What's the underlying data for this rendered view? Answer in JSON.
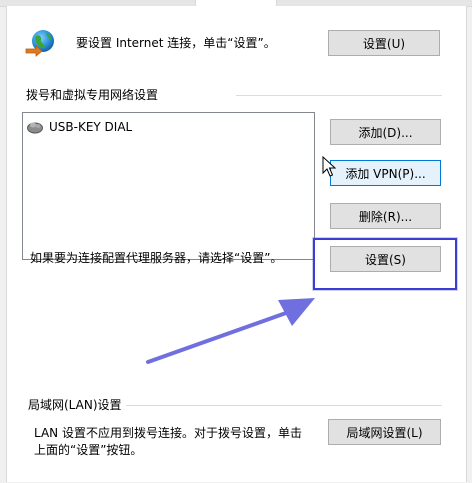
{
  "internet_setup": {
    "text": "要设置 Internet 连接，单击“设置”。",
    "button_label": "设置(U)",
    "icon": "internet-globe-icon"
  },
  "dialup_section": {
    "title": "拨号和虚拟专用网络设置",
    "connections": [
      {
        "name": "USB-KEY DIAL",
        "icon": "dialup-connection-icon"
      }
    ],
    "buttons": {
      "add": "添加(D)...",
      "add_vpn": "添加 VPN(P)...",
      "remove": "删除(R)..."
    },
    "proxy_text": "如果要为连接配置代理服务器，请选择“设置”。",
    "settings_label": "设置(S)"
  },
  "lan_section": {
    "title": "局域网(LAN)设置",
    "description_line1": "LAN 设置不应用到拨号连接。对于拨号设置，单击",
    "description_line2": "上面的“设置”按钮。",
    "button_label": "局域网设置(L)"
  },
  "annotation": {
    "highlight_color": "#3b3fd1",
    "arrow_color": "#6f6fe0"
  }
}
